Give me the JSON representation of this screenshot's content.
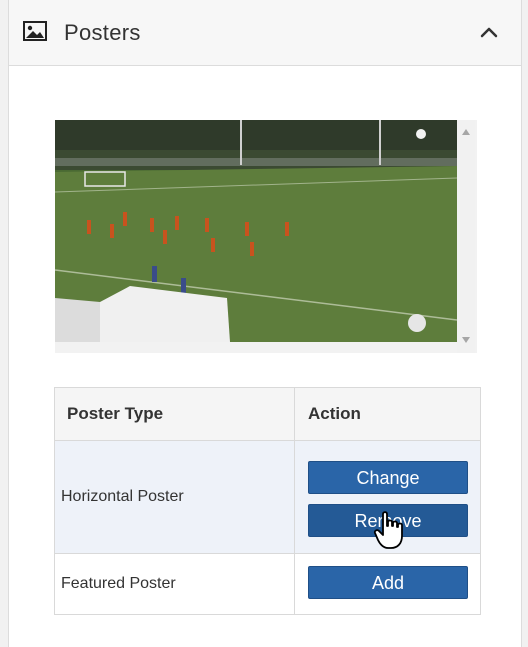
{
  "panel": {
    "title": "Posters",
    "header_icon": "image-icon",
    "collapse_icon": "chevron-up-icon"
  },
  "preview": {
    "alt": "Soccer field video frame poster preview"
  },
  "table": {
    "headers": [
      "Poster Type",
      "Action"
    ],
    "rows": [
      {
        "type": "Horizontal Poster",
        "actions": [
          "Change",
          "Remove"
        ]
      },
      {
        "type": "Featured Poster",
        "actions": [
          "Add"
        ]
      }
    ]
  },
  "colors": {
    "button": "#2a65a8",
    "row_highlight": "#eef2f9",
    "header_bg": "#f7f7f7"
  }
}
